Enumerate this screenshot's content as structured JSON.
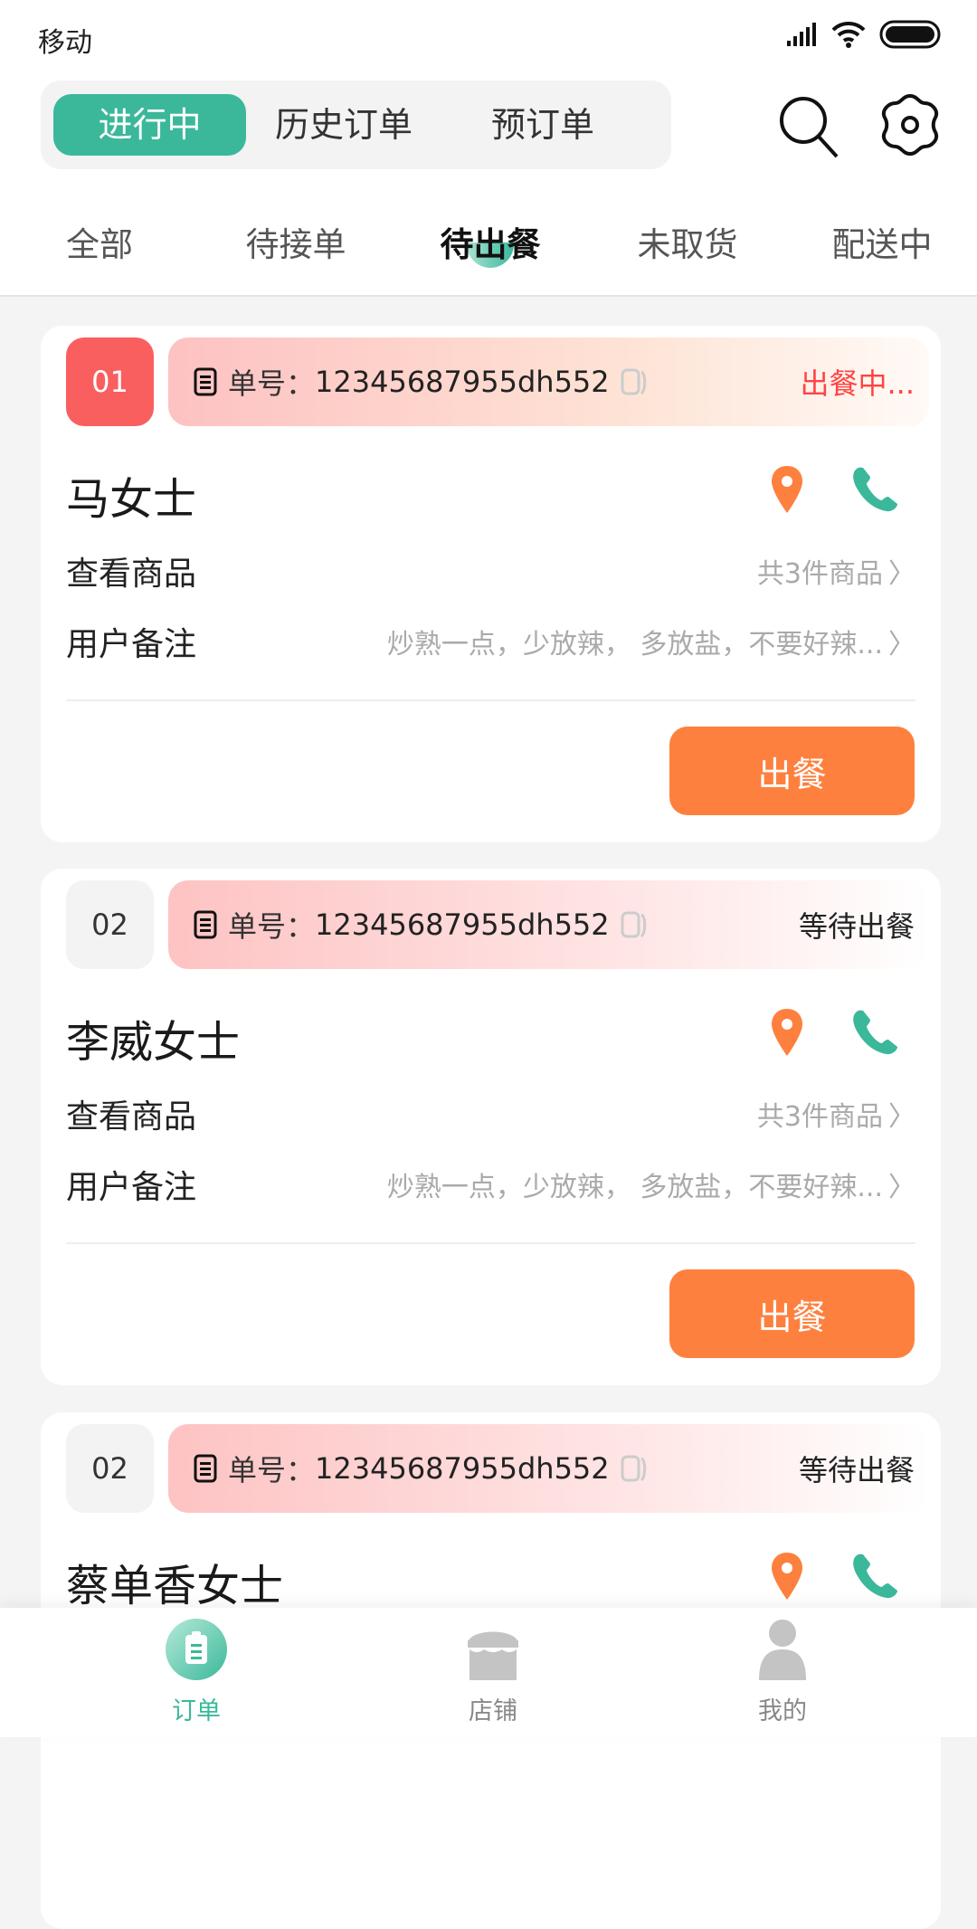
{
  "status_bar": {
    "carrier": "移动",
    "icons": [
      "signal-icon",
      "wifi-icon",
      "battery-icon"
    ]
  },
  "header": {
    "segments": [
      {
        "label": "进行中",
        "active": true
      },
      {
        "label": "历史订单",
        "active": false
      },
      {
        "label": "预订单",
        "active": false
      }
    ],
    "icons": [
      "search-icon",
      "settings-icon"
    ]
  },
  "sub_tabs": [
    {
      "label": "全部"
    },
    {
      "label": "待接单"
    },
    {
      "label": "待出餐",
      "active": true
    },
    {
      "label": "未取货"
    },
    {
      "label": "配送中"
    }
  ],
  "colors": {
    "accent": "#3bb89a",
    "orange": "#fe803e",
    "red": "#fa5f5f"
  },
  "orders": [
    {
      "index": "01",
      "order_label": "单号：",
      "order_no": "12345687955dh552",
      "status": "出餐中...",
      "customer": "马女士",
      "goods_label": "查看商品",
      "goods_value": "共3件商品",
      "note_label": "用户备注",
      "note_value": "炒熟一点，少放辣， 多放盐，不要好辣...",
      "action": "出餐"
    },
    {
      "index": "02",
      "order_label": "单号：",
      "order_no": "12345687955dh552",
      "status": "等待出餐",
      "customer": "李威女士",
      "goods_label": "查看商品",
      "goods_value": "共3件商品",
      "note_label": "用户备注",
      "note_value": "炒熟一点，少放辣， 多放盐，不要好辣...",
      "action": "出餐"
    },
    {
      "index": "02",
      "order_label": "单号：",
      "order_no": "12345687955dh552",
      "status": "等待出餐",
      "customer": "蔡单香女士"
    }
  ],
  "bottom_nav": [
    {
      "label": "订单",
      "icon": "clipboard-icon",
      "active": true
    },
    {
      "label": "店铺",
      "icon": "shop-icon"
    },
    {
      "label": "我的",
      "icon": "user-icon"
    }
  ]
}
